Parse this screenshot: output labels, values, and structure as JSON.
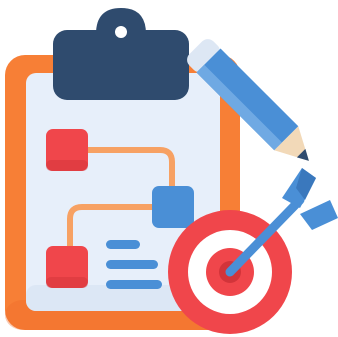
{
  "icon": {
    "name": "project-planning-icon",
    "parts": [
      "clipboard",
      "flowchart",
      "pencil",
      "target",
      "arrow"
    ]
  },
  "colors": {
    "clipboard_frame": "#F77F36",
    "clipboard_frame_shade": "#EE6A28",
    "paper": "#E7EFFA",
    "paper_shade": "#D5E1F2",
    "clip_dark": "#2F4B6E",
    "clip_hole": "#FFFFFF",
    "flow_node_red": "#F0464B",
    "flow_node_red_shade": "#D2343A",
    "flow_node_blue": "#4A8FD6",
    "flow_connector": "#F7A163",
    "text_lines_blue": "#4A8FD6",
    "pencil_body": "#4A8FD6",
    "pencil_tip_wood": "#F2D9B8",
    "pencil_tip_lead": "#2F4B6E",
    "pencil_eraser": "#DDE7F4",
    "target_outer": "#F0464B",
    "target_ring_white": "#FFFFFF",
    "target_inner": "#F0464B",
    "arrow_shaft": "#4A8FD6",
    "arrow_fletching": "#4A8FD6"
  }
}
